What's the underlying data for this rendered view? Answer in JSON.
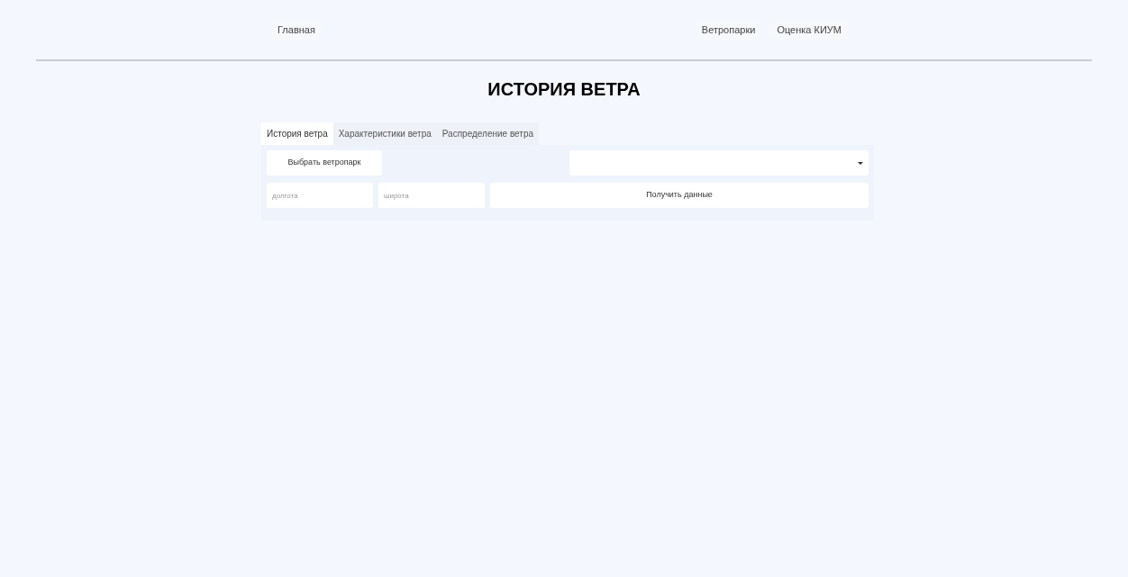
{
  "nav": {
    "left": [
      {
        "label": "Главная"
      }
    ],
    "right": [
      {
        "label": "Ветропарки"
      },
      {
        "label": "Оценка КИУМ"
      }
    ]
  },
  "title": "ИСТОРИЯ ВЕТРА",
  "tabs": [
    {
      "label": "История ветра",
      "selected": true
    },
    {
      "label": "Характеристики ветра",
      "selected": false
    },
    {
      "label": "Распределение ветра",
      "selected": false
    }
  ],
  "choose_button": "Выбрать ветропарк",
  "longitude": {
    "placeholder": "долгота"
  },
  "latitude": {
    "placeholder": "широта"
  },
  "submit_button": "Получить данные"
}
